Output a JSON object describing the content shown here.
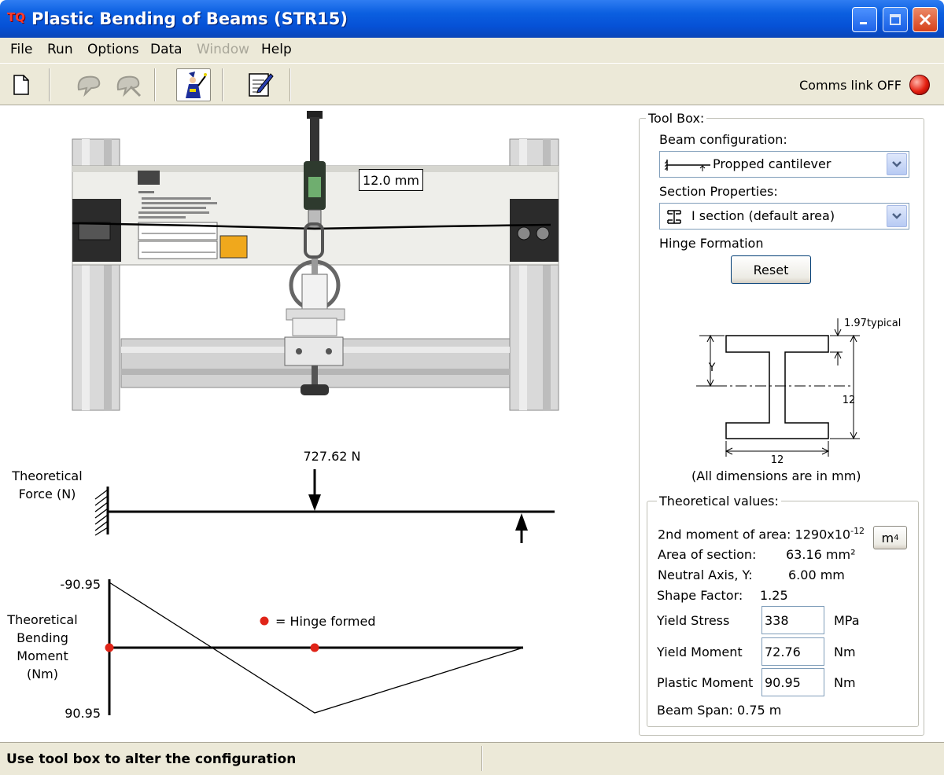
{
  "window": {
    "title": "Plastic Bending of Beams (STR15)",
    "app_icon": "TQ"
  },
  "menu": {
    "file": "File",
    "run": "Run",
    "options": "Options",
    "data": "Data",
    "window": "Window",
    "help": "Help"
  },
  "toolbar": {
    "comms_label": "Comms link OFF",
    "comms_status_color": "#e41f0f"
  },
  "apparatus": {
    "deflection_readout": "12.0 mm"
  },
  "force_diagram": {
    "label_line1": "Theoretical",
    "label_line2": "Force (N)",
    "load_value": "727.62 N"
  },
  "moment_diagram": {
    "label_lines": [
      "Theoretical",
      "Bending",
      "Moment",
      "(Nm)"
    ],
    "top_value": "-90.95",
    "bottom_value": "90.95",
    "legend": "= Hinge formed",
    "hinge_color": "#e02418"
  },
  "toolbox": {
    "legend": "Tool Box:",
    "beam_config_label": "Beam configuration:",
    "beam_config_value": "Propped cantilever",
    "section_label": "Section Properties:",
    "section_value": "I section (default area)",
    "hinge_label": "Hinge Formation",
    "reset_button": "Reset",
    "section_drawing": {
      "flange_note": "1.97typical",
      "y_label": "Y",
      "height_dim": "12",
      "width_dim": "12",
      "note": "(All dimensions are in mm)"
    }
  },
  "theoretical": {
    "legend": "Theoretical values:",
    "moment_of_area_label": "2nd moment of area:",
    "moment_of_area_value": "1290x10",
    "moment_of_area_exp": "-12",
    "unit_button": "m",
    "unit_button_exp": "4",
    "area_label": "Area of section:",
    "area_value": "63.16 mm²",
    "neutral_axis_label": "Neutral Axis, Y:",
    "neutral_axis_value": "6.00 mm",
    "shape_factor_label": "Shape Factor:",
    "shape_factor_value": "1.25",
    "yield_stress_label": "Yield Stress",
    "yield_stress_value": "338",
    "yield_stress_unit": "MPa",
    "yield_moment_label": "Yield Moment",
    "yield_moment_value": "72.76",
    "yield_moment_unit": "Nm",
    "plastic_moment_label": "Plastic Moment",
    "plastic_moment_value": "90.95",
    "plastic_moment_unit": "Nm",
    "beam_span_label": "Beam Span:",
    "beam_span_value": "0.75 m"
  },
  "status": {
    "message": "Use tool box to alter the configuration"
  }
}
